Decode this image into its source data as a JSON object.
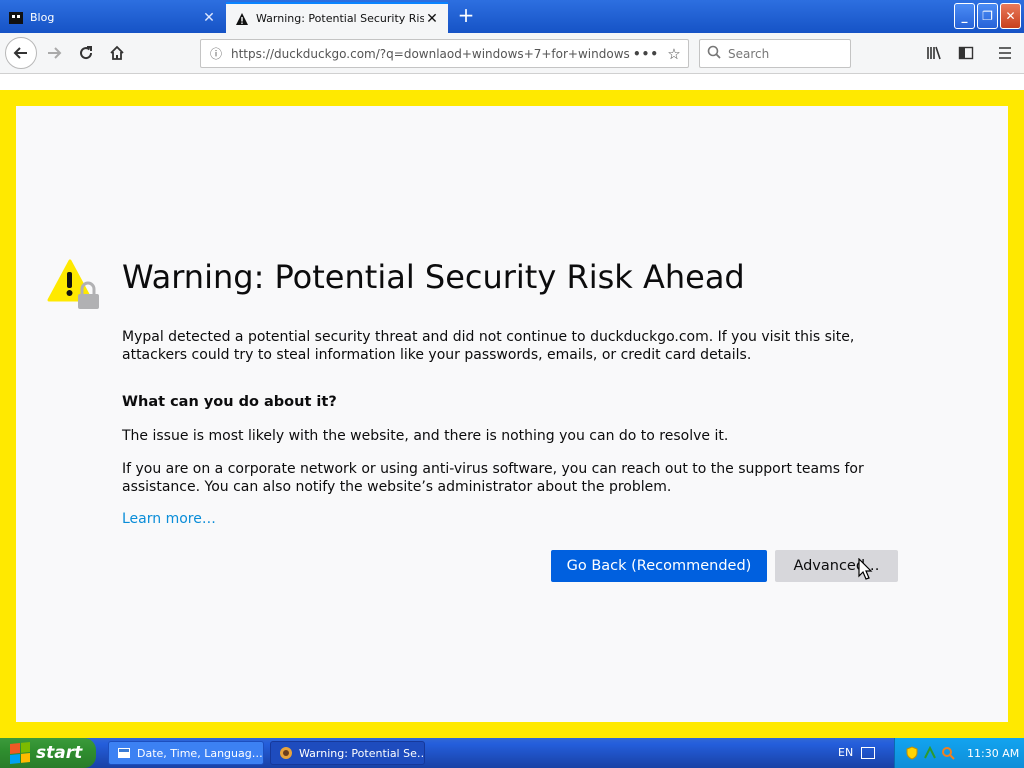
{
  "tabs": [
    {
      "title": "Blog",
      "active": false
    },
    {
      "title": "Warning: Potential Security Risk Ahead",
      "active": true
    }
  ],
  "navbar": {
    "url": "https://duckduckgo.com/?q=downlaod+windows+7+for+windows",
    "search_placeholder": "Search"
  },
  "page": {
    "heading": "Warning: Potential Security Risk Ahead",
    "intro": "Mypal detected a potential security threat and did not continue to duckduckgo.com. If you visit this site, attackers could try to steal information like your passwords, emails, or credit card details.",
    "subheading": "What can you do about it?",
    "para1": "The issue is most likely with the website, and there is nothing you can do to resolve it.",
    "para2": "If you are on a corporate network or using anti-virus software, you can reach out to the support teams for assistance. You can also notify the website’s administrator about the problem.",
    "learn_more": "Learn more…",
    "go_back_label": "Go Back (Recommended)",
    "advanced_label": "Advanced…"
  },
  "taskbar": {
    "start_label": "start",
    "tasks": [
      {
        "label": "Date, Time, Languag…"
      },
      {
        "label": "Warning: Potential Se…"
      }
    ],
    "language": "EN",
    "clock": "11:30 AM"
  },
  "colors": {
    "warning_border": "#ffe900",
    "primary_button": "#0060df",
    "link": "#0a8dd8"
  }
}
